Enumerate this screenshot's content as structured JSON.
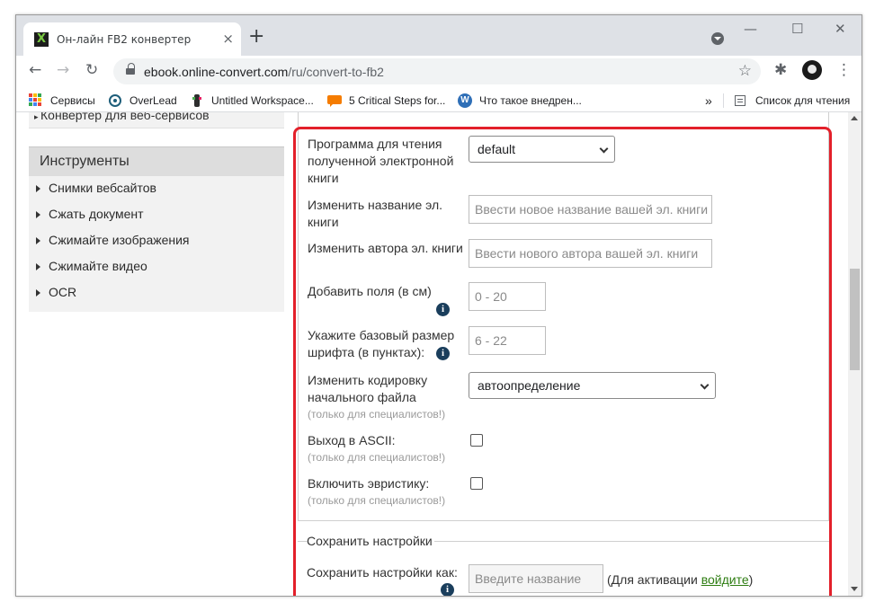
{
  "browser": {
    "tab_title": "Он-лайн FB2 конвертер",
    "tab_close": "×",
    "new_tab": "+",
    "window_controls": [
      "—",
      "☐",
      "✕"
    ],
    "url_host": "ebook.online-convert.com",
    "url_path": "/ru/convert-to-fb2",
    "icons": {
      "back": "←",
      "forward": "→",
      "reload": "↻",
      "star": "☆",
      "extensions": "✱",
      "menu": "⋮"
    }
  },
  "bookmarks": {
    "items": [
      "Сервисы",
      "OverLead",
      "Untitled Workspace...",
      "5 Critical Steps for...",
      "Что такое внедрен..."
    ],
    "overflow": "»",
    "reading_list": "Список для чтения"
  },
  "sidebar": {
    "cut_item": "Конвертер для веб-сервисов",
    "tools_title": "Инструменты",
    "tools": [
      "Снимки вебсайтов",
      "Сжать документ",
      "Сжимайте изображения",
      "Сжимайте видео",
      "OCR"
    ]
  },
  "form": {
    "reader_label": "Программа для чтения полученной электронной книги",
    "reader_value": "default",
    "title_label": "Изменить название эл. книги",
    "title_placeholder": "Ввести новое название вашей эл. книги",
    "author_label": "Изменить автора эл. книги",
    "author_placeholder": "Ввести нового автора вашей эл. книги",
    "margins_label": "Добавить поля (в см)",
    "margins_placeholder": "0 - 20",
    "font_label": "Укажите базовый размер шрифта (в пунктах):",
    "font_placeholder": "6 - 22",
    "encoding_label": "Изменить кодировку начального файла",
    "encoding_value": "автоопределение",
    "specialists_note": "(только для специалистов!)",
    "ascii_label": "Выход в ASCII:",
    "heuristics_label": "Включить эвристику:",
    "info_glyph": "i"
  },
  "save": {
    "legend": "Сохранить настройки",
    "label": "Сохранить настройки как:",
    "placeholder": "Введите название",
    "activation_prefix": "(Для активации ",
    "login_link": "войдите",
    "activation_suffix": ")"
  },
  "colors": {
    "highlight": "#e3202a",
    "link": "#2e7d12",
    "info_icon": "#1a3e5c"
  }
}
